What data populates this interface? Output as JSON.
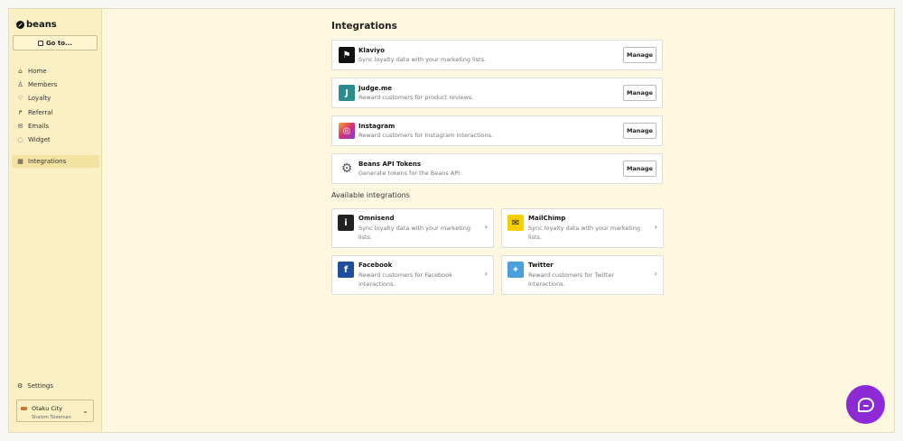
{
  "brand": {
    "name": "beans"
  },
  "sidebar": {
    "goto_label": "Go to...",
    "items": [
      {
        "label": "Home",
        "icon": "home-icon"
      },
      {
        "label": "Members",
        "icon": "user-icon"
      },
      {
        "label": "Loyalty",
        "icon": "heart-icon"
      },
      {
        "label": "Referral",
        "icon": "share-icon"
      },
      {
        "label": "Emails",
        "icon": "mail-icon"
      },
      {
        "label": "Widget",
        "icon": "chat-icon"
      },
      {
        "label": "Integrations",
        "icon": "grid-icon",
        "active": true
      }
    ],
    "settings_label": "Settings",
    "account": {
      "name": "Otaku City",
      "user": "Shalom Tsleeman"
    }
  },
  "main": {
    "title": "Integrations",
    "installed": [
      {
        "name": "Klaviyo",
        "desc": "Sync loyalty data with your marketing lists.",
        "action": "Manage",
        "color": "#111111",
        "glyph": "⚑"
      },
      {
        "name": "Judge.me",
        "desc": "Reward customers for product reviews.",
        "action": "Manage",
        "color": "#2a8c8c",
        "glyph": "J"
      },
      {
        "name": "Instagram",
        "desc": "Reward customers for Instagram interactions.",
        "action": "Manage",
        "color": "#d6307a",
        "glyph": "◎"
      },
      {
        "name": "Beans API Tokens",
        "desc": "Generate tokens for the Beans API.",
        "action": "Manage",
        "color": "#ffffff",
        "glyph": "⚙"
      }
    ],
    "available_title": "Available integrations",
    "available": [
      {
        "name": "Omnisend",
        "desc": "Sync loyalty data with your marketing lists.",
        "color": "#222222",
        "glyph": "i"
      },
      {
        "name": "MailChimp",
        "desc": "Sync loyalty data with your marketing lists.",
        "color": "#f5d000",
        "glyph": "✉"
      },
      {
        "name": "Facebook",
        "desc": "Reward customers for Facebook interactions.",
        "color": "#1e4f9c",
        "glyph": "f"
      },
      {
        "name": "Twitter",
        "desc": "Reward customers for Twitter interactions.",
        "color": "#4aa0dc",
        "glyph": "✦"
      }
    ]
  }
}
